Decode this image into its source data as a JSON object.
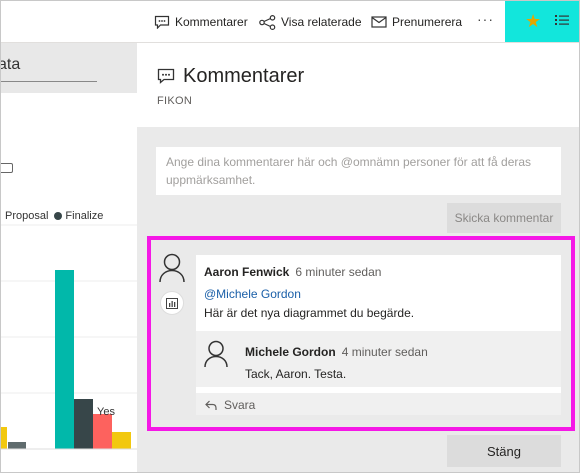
{
  "toolbar": {
    "comments_label": "Kommentarer",
    "related_label": "Visa relaterade",
    "subscribe_label": "Prenumerera",
    "more_label": "···",
    "favorite_icon": "star-icon",
    "favorite_color": "#e5a700",
    "accent_color": "#12e6dc"
  },
  "report": {
    "title_fragment": "ata",
    "legend": [
      "Proposal",
      "Finalize"
    ],
    "x_tick": "Yes"
  },
  "pane": {
    "title": "Kommentarer",
    "subtitle": "FIKON",
    "input_placeholder": "Ange dina kommentarer här och @omnämn personer för att få deras uppmärksamhet.",
    "send_label": "Skicka kommentar",
    "close_label": "Stäng"
  },
  "comment": {
    "author": "Aaron Fenwick",
    "time": "6 minuter sedan",
    "mention": "@Michele Gordon",
    "text": "Här är det nya diagrammet du begärde.",
    "reply": {
      "author": "Michele Gordon",
      "time": "4 minuter sedan",
      "text": "Tack, Aaron. Testa."
    },
    "reply_action": "Svara"
  },
  "colors": {
    "highlight": "#f518e6",
    "teal": "#01b8aa",
    "dark": "#374649",
    "red": "#fd625e",
    "yellow": "#f2c80f",
    "mention": "#1a5fa8"
  }
}
